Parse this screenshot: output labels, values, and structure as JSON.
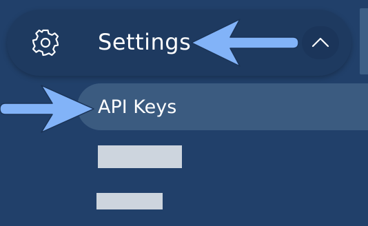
{
  "sidebar": {
    "settings": {
      "icon": "gear-icon",
      "label": "Settings",
      "toggle_icon": "chevron-up-icon"
    },
    "items": [
      {
        "label": "API Keys",
        "active": true
      }
    ],
    "placeholders": 2
  },
  "annotations": {
    "arrow_color": "#82b3f8",
    "arrows": [
      "settings-pointer",
      "api-keys-pointer"
    ]
  },
  "colors": {
    "background": "#21406a",
    "settings_row": "#1e3a60",
    "active_item": "#3b5b80"
  }
}
